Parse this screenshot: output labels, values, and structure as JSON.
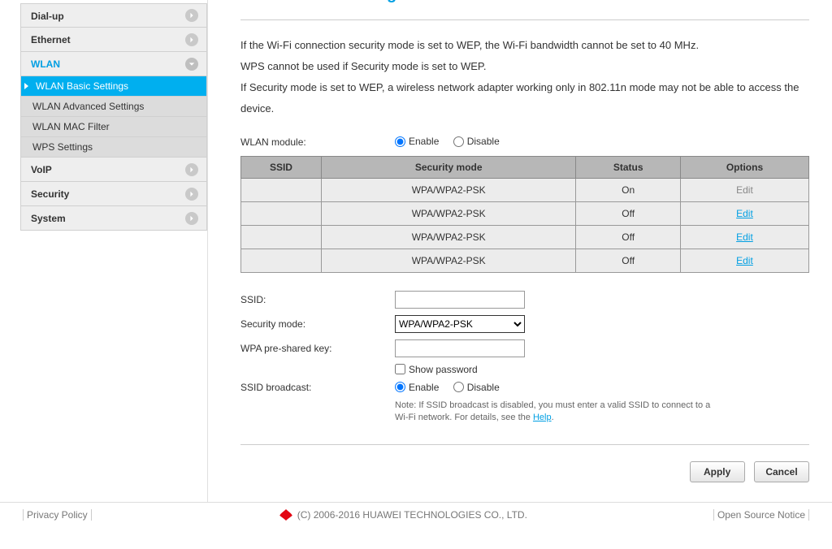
{
  "sidebar": {
    "items": [
      {
        "label": "Dial-up"
      },
      {
        "label": "Ethernet"
      },
      {
        "label": "WLAN"
      },
      {
        "label": "VoIP"
      },
      {
        "label": "Security"
      },
      {
        "label": "System"
      }
    ],
    "wlan_sub": [
      {
        "label": "WLAN Basic Settings"
      },
      {
        "label": "WLAN Advanced Settings"
      },
      {
        "label": "WLAN MAC Filter"
      },
      {
        "label": "WPS Settings"
      }
    ]
  },
  "main": {
    "heading_partial": "WLAN Basic Settings",
    "desc1": "If the Wi-Fi connection security mode is set to WEP, the Wi-Fi bandwidth cannot be set to 40 MHz.",
    "desc2": "WPS cannot be used if Security mode is set to WEP.",
    "desc3": "If Security mode is set to WEP, a wireless network adapter working only in 802.11n mode may not be able to access the device.",
    "wlan_module_label": "WLAN module:",
    "enable": "Enable",
    "disable": "Disable",
    "table": {
      "headers": [
        "SSID",
        "Security mode",
        "Status",
        "Options"
      ],
      "rows": [
        {
          "ssid": "",
          "mode": "WPA/WPA2-PSK",
          "status": "On",
          "opt": "Edit",
          "muted": true
        },
        {
          "ssid": "",
          "mode": "WPA/WPA2-PSK",
          "status": "Off",
          "opt": "Edit",
          "muted": false
        },
        {
          "ssid": "",
          "mode": "WPA/WPA2-PSK",
          "status": "Off",
          "opt": "Edit",
          "muted": false
        },
        {
          "ssid": "",
          "mode": "WPA/WPA2-PSK",
          "status": "Off",
          "opt": "Edit",
          "muted": false
        }
      ]
    },
    "form": {
      "ssid_label": "SSID:",
      "ssid_value": "",
      "security_label": "Security mode:",
      "security_value": "WPA/WPA2-PSK",
      "key_label": "WPA pre-shared key:",
      "key_value": "",
      "show_password": "Show password",
      "broadcast_label": "SSID broadcast:",
      "note_pre": "Note: If SSID broadcast is disabled, you must enter a valid SSID to connect to a Wi-Fi network. For details, see the ",
      "help": "Help",
      "note_post": "."
    },
    "apply": "Apply",
    "cancel": "Cancel"
  },
  "footer": {
    "privacy": "Privacy Policy",
    "copyright": "(C) 2006-2016 HUAWEI TECHNOLOGIES CO., LTD.",
    "opensource": "Open Source Notice"
  }
}
